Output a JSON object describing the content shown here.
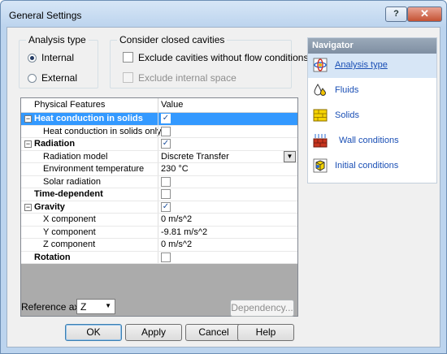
{
  "window": {
    "title": "General Settings",
    "help_glyph": "?",
    "close_glyph": "✕"
  },
  "analysis_type": {
    "group_label": "Analysis type",
    "options": [
      {
        "label": "Internal",
        "selected": true
      },
      {
        "label": "External",
        "selected": false
      }
    ]
  },
  "cavities": {
    "group_label": "Consider closed cavities",
    "exclude_no_flow_label": "Exclude cavities without flow conditions",
    "exclude_internal_label": "Exclude internal space"
  },
  "grid": {
    "col_feature": "Physical Features",
    "col_value": "Value",
    "rows": [
      {
        "name": "Heat conduction in solids",
        "value_type": "check",
        "checked": true,
        "value": "",
        "level": 0,
        "expander": "−",
        "selected": true,
        "bold": true
      },
      {
        "name": "Heat conduction in solids only",
        "value_type": "check",
        "checked": false,
        "value": "",
        "level": 1,
        "expander": "",
        "selected": false,
        "bold": false
      },
      {
        "name": "Radiation",
        "value_type": "check",
        "checked": true,
        "value": "",
        "level": 0,
        "expander": "−",
        "selected": false,
        "bold": true
      },
      {
        "name": "Radiation model",
        "value_type": "dropdown",
        "checked": false,
        "value": "Discrete Transfer",
        "level": 1,
        "expander": "",
        "selected": false,
        "bold": false
      },
      {
        "name": "Environment temperature",
        "value_type": "text",
        "checked": false,
        "value": "230 °C",
        "level": 1,
        "expander": "",
        "selected": false,
        "bold": false
      },
      {
        "name": "Solar radiation",
        "value_type": "check",
        "checked": false,
        "value": "",
        "level": 1,
        "expander": "",
        "selected": false,
        "bold": false
      },
      {
        "name": "Time-dependent",
        "value_type": "check",
        "checked": false,
        "value": "",
        "level": 0,
        "expander": "",
        "selected": false,
        "bold": true
      },
      {
        "name": "Gravity",
        "value_type": "check",
        "checked": true,
        "value": "",
        "level": 0,
        "expander": "−",
        "selected": false,
        "bold": true
      },
      {
        "name": "X component",
        "value_type": "text",
        "checked": false,
        "value": "0 m/s^2",
        "level": 1,
        "expander": "",
        "selected": false,
        "bold": false
      },
      {
        "name": "Y component",
        "value_type": "text",
        "checked": false,
        "value": "-9.81 m/s^2",
        "level": 1,
        "expander": "",
        "selected": false,
        "bold": false
      },
      {
        "name": "Z component",
        "value_type": "text",
        "checked": false,
        "value": "0 m/s^2",
        "level": 1,
        "expander": "",
        "selected": false,
        "bold": false
      },
      {
        "name": "Rotation",
        "value_type": "check",
        "checked": false,
        "value": "",
        "level": 0,
        "expander": "",
        "selected": false,
        "bold": true
      }
    ]
  },
  "reference_axis": {
    "label": "Reference axis:",
    "value": "Z"
  },
  "buttons": {
    "dependency": "Dependency...",
    "ok": "OK",
    "apply": "Apply",
    "cancel": "Cancel",
    "help": "Help"
  },
  "navigator": {
    "title": "Navigator",
    "items": [
      {
        "label": "Analysis type",
        "icon": "analysis-type-icon",
        "active": true
      },
      {
        "label": "Fluids",
        "icon": "fluids-icon",
        "active": false
      },
      {
        "label": "Solids",
        "icon": "solids-icon",
        "active": false
      },
      {
        "label": "Wall conditions",
        "icon": "wall-conditions-icon",
        "active": false
      },
      {
        "label": "Initial conditions",
        "icon": "initial-conditions-icon",
        "active": false
      }
    ]
  }
}
